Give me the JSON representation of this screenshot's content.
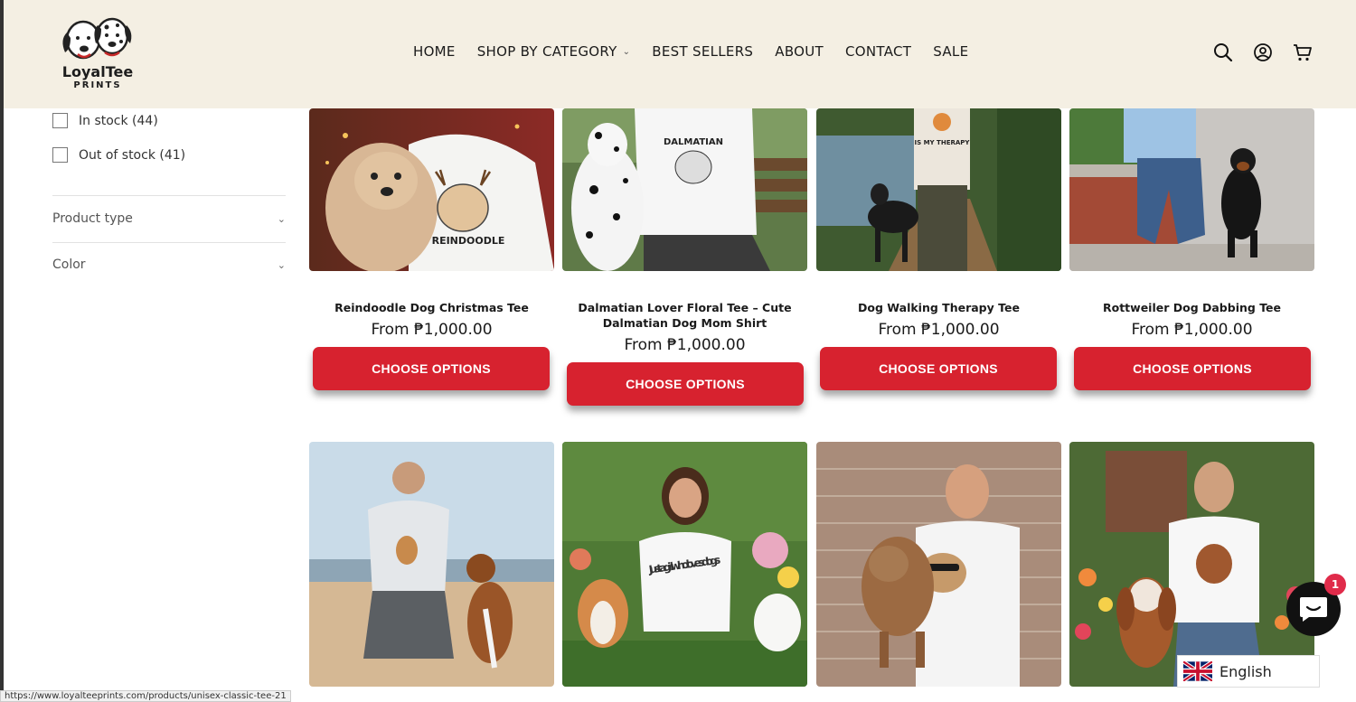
{
  "brand": {
    "name": "LoyalTee",
    "sub": "PRINTS"
  },
  "nav": {
    "items": [
      {
        "label": "HOME"
      },
      {
        "label": "SHOP BY CATEGORY",
        "has_dropdown": true
      },
      {
        "label": "BEST SELLERS"
      },
      {
        "label": "ABOUT"
      },
      {
        "label": "CONTACT"
      },
      {
        "label": "SALE"
      }
    ],
    "icons": [
      "search-icon",
      "account-icon",
      "cart-icon"
    ]
  },
  "filters": {
    "availability": [
      {
        "label": "In stock (44)",
        "checked": false
      },
      {
        "label": "Out of stock (41)",
        "checked": false
      }
    ],
    "accordions": [
      {
        "label": "Product type"
      },
      {
        "label": "Color"
      }
    ]
  },
  "products": [
    {
      "name": "Reindoodle Dog Christmas Tee",
      "price": "From ₱1,000.00",
      "button": "CHOOSE OPTIONS"
    },
    {
      "name": "Dalmatian Lover Floral Tee – Cute Dalmatian Dog Mom Shirt",
      "name_line1": "Dalmatian Lover Floral Tee – Cute",
      "name_line2": "Dalmatian Dog Mom Shirt",
      "price": "From ₱1,000.00",
      "button": "CHOOSE OPTIONS"
    },
    {
      "name": "Dog Walking Therapy Tee",
      "price": "From ₱1,000.00",
      "button": "CHOOSE OPTIONS"
    },
    {
      "name": "Rottweiler Dog Dabbing Tee",
      "price": "From ₱1,000.00",
      "button": "CHOOSE OPTIONS"
    }
  ],
  "product_images": {
    "row1": [
      "REINDOODLE",
      "DALMATIAN",
      "IS MY THERAPY",
      ""
    ],
    "row2_shirt_text": "Just a girl who loves dogs"
  },
  "chat": {
    "badge": "1"
  },
  "language": {
    "label": "English"
  },
  "status_url": "https://www.loyalteeprints.com/products/unisex-classic-tee-21",
  "colors": {
    "header_bg": "#f4efe3",
    "button_red": "#d7222f",
    "badge_pink": "#e02b4a"
  }
}
